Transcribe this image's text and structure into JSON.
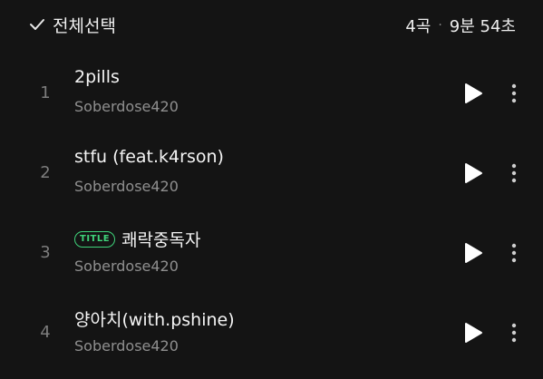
{
  "header": {
    "select_all_label": "전체선택",
    "track_count": "4곡",
    "separator": "·",
    "total_duration": "9분 54초",
    "check_icon": "check-icon"
  },
  "tracks": [
    {
      "number": "1",
      "title": "2pills",
      "artist": "Soberdose420",
      "badge": ""
    },
    {
      "number": "2",
      "title": "stfu (feat.k4rson)",
      "artist": "Soberdose420",
      "badge": ""
    },
    {
      "number": "3",
      "title": "쾌락중독자",
      "artist": "Soberdose420",
      "badge": "TITLE"
    },
    {
      "number": "4",
      "title": "양아치(with.pshine)",
      "artist": "Soberdose420",
      "badge": ""
    }
  ],
  "colors": {
    "background": "#141414",
    "badge_green": "#3fd37a",
    "secondary_text": "#8f8f8f"
  },
  "icons": {
    "play": "play-icon",
    "more": "more-vertical-icon"
  }
}
